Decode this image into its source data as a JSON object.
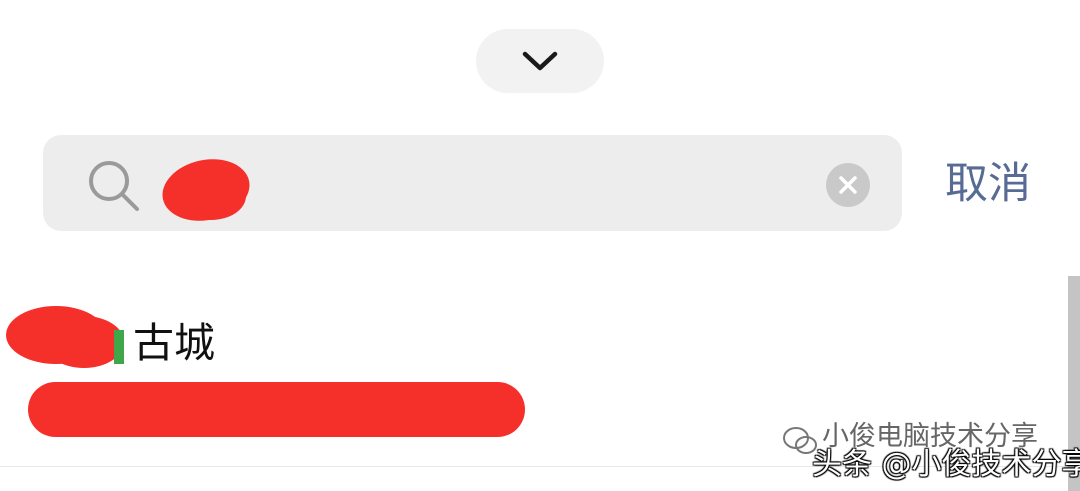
{
  "header": {
    "collapse_icon": "chevron-down-icon"
  },
  "search": {
    "icon": "search-icon",
    "clear_icon": "clear-icon",
    "query_visible": "",
    "cancel_label": "取消"
  },
  "results": [
    {
      "title_visible": "古城"
    }
  ],
  "watermarks": {
    "wechat_account": "小俊电脑技术分享",
    "toutiao": "头条 @小俊技术分享"
  },
  "colors": {
    "cancel_link": "#576b95",
    "search_bg": "#ededed",
    "redaction": "#f5302b"
  }
}
